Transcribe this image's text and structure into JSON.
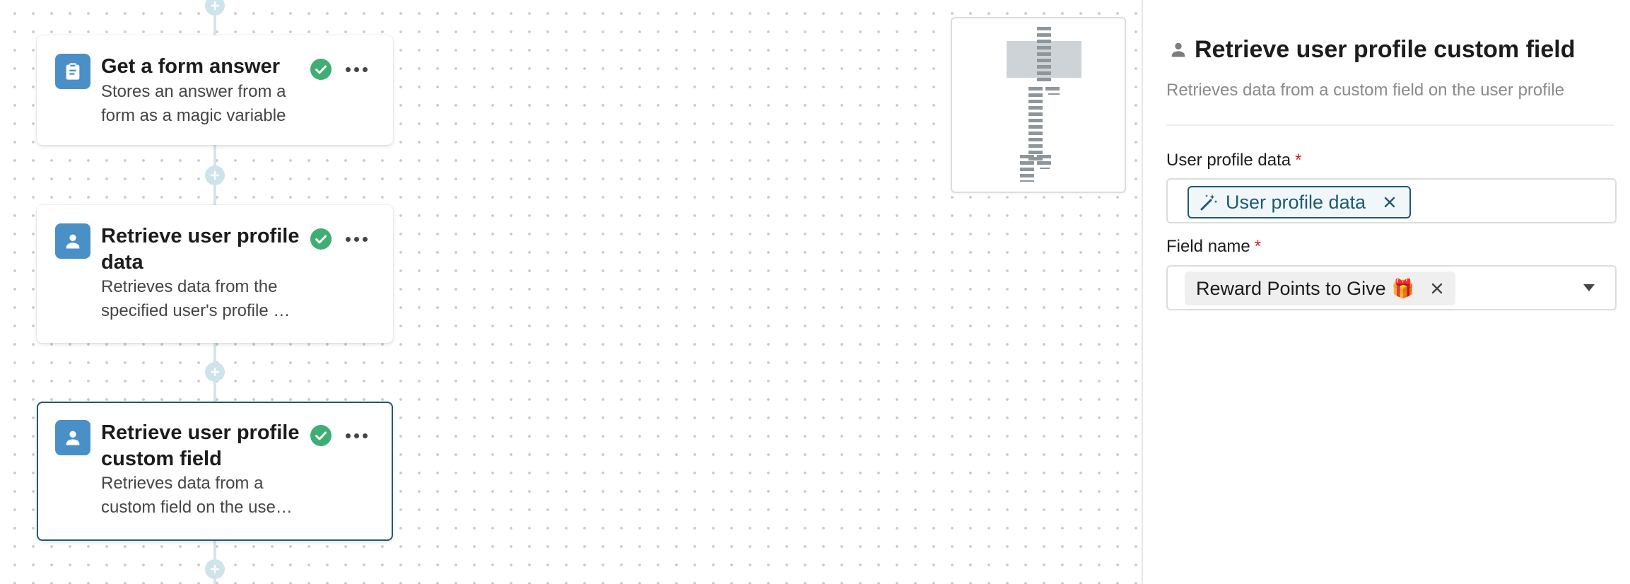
{
  "steps": [
    {
      "title": "Get a form answer",
      "description": "Stores an answer from a form as a magic variable",
      "icon": "clipboard-icon",
      "status": "complete"
    },
    {
      "title": "Retrieve user profile data",
      "description": "Retrieves data from the specified user's profile …",
      "icon": "user-icon",
      "status": "complete"
    },
    {
      "title": "Retrieve user profile custom field",
      "description": "Retrieves data from a custom field on the use…",
      "icon": "user-icon",
      "status": "complete",
      "selected": true
    }
  ],
  "panel": {
    "title": "Retrieve user profile custom field",
    "subtitle": "Retrieves data from a custom field on the user profile",
    "fields": {
      "user_profile_data": {
        "label": "User profile data",
        "required_mark": "*",
        "token": "User profile data"
      },
      "field_name": {
        "label": "Field name",
        "required_mark": "*",
        "token": "Reward Points to Give",
        "token_emoji": "🎁"
      }
    }
  },
  "colors": {
    "accent": "#1e5a70",
    "step_icon_bg": "#4a90c7",
    "success": "#3fae73",
    "required": "#c0232b",
    "connector": "#d5e4ea"
  }
}
